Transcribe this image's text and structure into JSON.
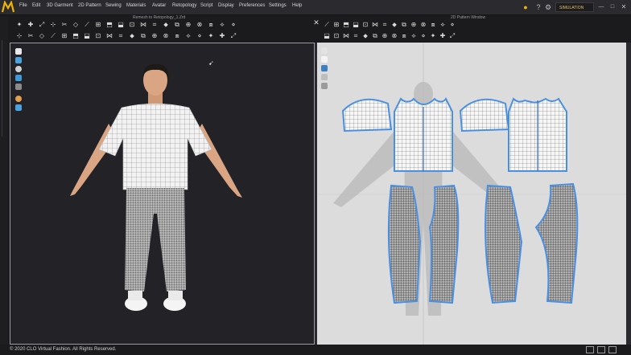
{
  "menu": {
    "items": [
      "File",
      "Edit",
      "3D Garment",
      "2D Pattern",
      "Sewing",
      "Materials",
      "Avatar",
      "Retopology",
      "Script",
      "Display",
      "Preferences",
      "Settings",
      "Help"
    ]
  },
  "toolbar": {
    "simulation_label": "SIMULATION"
  },
  "panels": {
    "left_title": "Remesh to Retopology_1.Zrd",
    "right_title": "2D Pattern Window"
  },
  "footer": {
    "copyright": "© 2020 CLO Virtual Fashion. All Rights Reserved."
  },
  "icons": {
    "logo": "clo-logo",
    "close": "close-icon",
    "colors": {
      "accent": "#f0b400",
      "pattern_outline": "#4a90e2",
      "viewport_bg": "#232226",
      "pattern_bg": "#dcdcdc"
    }
  }
}
